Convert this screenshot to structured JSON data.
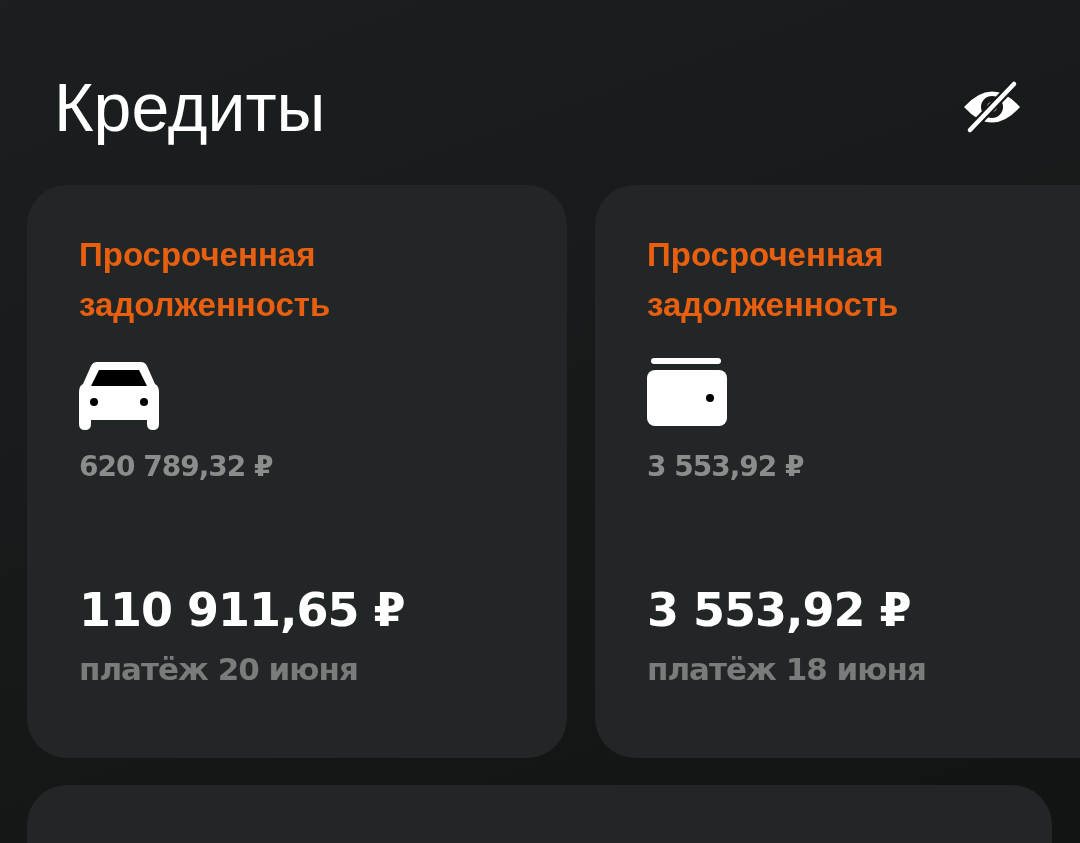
{
  "header": {
    "title": "Кредиты"
  },
  "cards": [
    {
      "kind": "car",
      "status": "Просроченная задолженность",
      "balance": "620 789,32 ₽",
      "amount": "110 911,65 ₽",
      "payment": "платёж 20 июня"
    },
    {
      "kind": "wallet",
      "status": "Просроченная задолженность",
      "balance": "3 553,92 ₽",
      "amount": "3 553,92 ₽",
      "payment": "платёж 18 июня"
    }
  ]
}
